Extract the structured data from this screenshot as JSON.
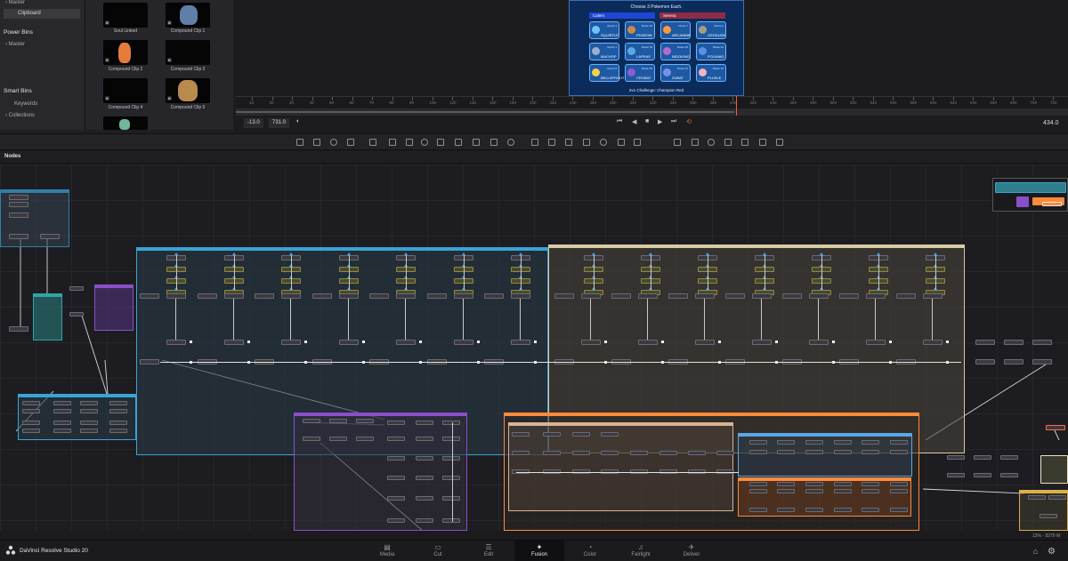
{
  "sidebar": {
    "items": [
      {
        "label": "Master"
      },
      {
        "label": "Clipboard"
      }
    ],
    "power_bins": {
      "heading": "Power Bins",
      "items": [
        {
          "label": "Master"
        }
      ]
    },
    "smart_bins": {
      "heading": "Smart Bins",
      "items": [
        {
          "label": "Keywords"
        },
        {
          "label": "Collections"
        }
      ]
    }
  },
  "media_pool": {
    "clips": [
      {
        "label": "Soul Linked"
      },
      {
        "label": "Compound Clip 1"
      },
      {
        "label": "Compound Clip 2"
      },
      {
        "label": "Compound Clip 3"
      },
      {
        "label": "Compound Clip 4"
      },
      {
        "label": "Compound Clip 5"
      }
    ]
  },
  "viewer": {
    "title": "Choose 3 Pokemon Each.",
    "team_left": "Calem",
    "team_right": "Serena",
    "pokemon": [
      {
        "name": "SQUIRTLE",
        "route": "Route 3",
        "color": "#6fc3ff"
      },
      {
        "name": "FEAROW",
        "route": "Route 16",
        "color": "#c98b4a"
      },
      {
        "name": "ARCANINE",
        "route": "Route 7",
        "color": "#ff9a3a"
      },
      {
        "name": "GEODUDE",
        "route": "Route 2",
        "color": "#a49e86"
      },
      {
        "name": "MACHOP",
        "route": "Route 4",
        "color": "#9db0c9"
      },
      {
        "name": "LAPRAS",
        "route": "Route 19",
        "color": "#5aa9e6"
      },
      {
        "name": "NIDOKING",
        "route": "Route 18",
        "color": "#b76ad0"
      },
      {
        "name": "POLIWAG",
        "route": "Route 12",
        "color": "#5b8fe0"
      },
      {
        "name": "BELLSPROUT",
        "route": "Route 6",
        "color": "#f2d24a"
      },
      {
        "name": "CROBAT",
        "route": "Route 10",
        "color": "#8f5bd0"
      },
      {
        "name": "ZUBAT",
        "route": "Route 11",
        "color": "#7b8fe8"
      },
      {
        "name": "PLUSLE",
        "route": "Route 14",
        "color": "#f3b3c3"
      }
    ],
    "footer": "2v1 Challenge: Champion Red",
    "ruler_ticks": [
      "10",
      "20",
      "30",
      "40",
      "50",
      "60",
      "70",
      "80",
      "90",
      "100",
      "120",
      "140",
      "160",
      "180",
      "200",
      "220",
      "240",
      "260",
      "280",
      "300",
      "320",
      "340",
      "360",
      "380",
      "400",
      "420",
      "440",
      "460",
      "480",
      "500",
      "520",
      "540",
      "560",
      "580",
      "600",
      "620",
      "640",
      "660",
      "680",
      "700",
      "720"
    ]
  },
  "transport": {
    "start": "-13.0",
    "end": "731.0",
    "current": "434.0"
  },
  "nodes": {
    "title": "Nodes",
    "zoom_status": "13% - 8270 M"
  },
  "bottom_bar": {
    "brand": "DaVinci Resolve Studio 20",
    "pages": [
      {
        "label": "Media",
        "icon": "media-icon"
      },
      {
        "label": "Cut",
        "icon": "cut-icon"
      },
      {
        "label": "Edit",
        "icon": "edit-icon"
      },
      {
        "label": "Fusion",
        "icon": "fusion-icon",
        "active": true
      },
      {
        "label": "Color",
        "icon": "color-icon"
      },
      {
        "label": "Fairlight",
        "icon": "fairlight-icon"
      },
      {
        "label": "Deliver",
        "icon": "deliver-icon"
      }
    ]
  },
  "colors": {
    "accent_playhead": "#ff5a3c",
    "group_blue": "#3aa3d6",
    "group_tan": "#d9cba3",
    "group_purple": "#8a4fc9",
    "group_orange": "#ff8a3a"
  }
}
